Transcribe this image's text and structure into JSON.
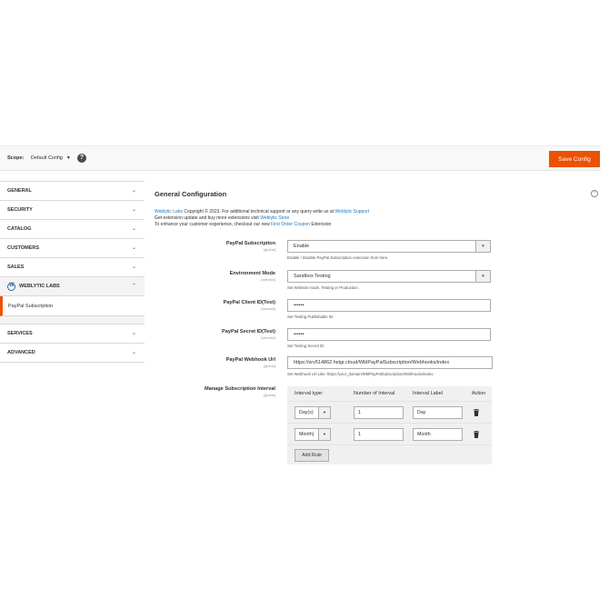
{
  "scope": {
    "label": "Scope:",
    "value": "Default Config",
    "help": "?"
  },
  "save_label": "Save Config",
  "sidebar": {
    "items": [
      {
        "label": "GENERAL"
      },
      {
        "label": "SECURITY"
      },
      {
        "label": "CATALOG"
      },
      {
        "label": "CUSTOMERS"
      },
      {
        "label": "SALES"
      },
      {
        "label": "WEBLYTIC LABS"
      },
      {
        "label": "SERVICES"
      },
      {
        "label": "ADVANCED"
      }
    ],
    "sub_item": "PayPal Subscription"
  },
  "section": {
    "title": "General Configuration",
    "intro": {
      "l1_link": "Weblytic Labs",
      "l1_text": " Copyright © 2023. For additional technical support or any query write us at ",
      "l1_link2": "Weblytic Support",
      "l2_text": "Get extension update and buy more extensions visit ",
      "l2_link": "Weblytic Store",
      "l3_text": "To enhance your customer experience, checkout our new ",
      "l3_link": "First Order Coupon",
      "l3_text2": " Extension"
    }
  },
  "fields": {
    "paypal_subscription": {
      "label": "PayPal Subscription",
      "scope": "[global]",
      "value": "Enable",
      "note": "Enable / Disable PayPal Subscription extension from here."
    },
    "environment_mode": {
      "label": "Environment Mode",
      "scope": "[website]",
      "value": "Sandbox Testing",
      "note": "Set Website mode, Testing or Production."
    },
    "client_id": {
      "label": "PayPal Client ID(Test)",
      "scope": "[website]",
      "value": "••••••",
      "note": "Set Testing Publishable ID."
    },
    "secret_id": {
      "label": "PayPal Secret ID(Test)",
      "scope": "[website]",
      "value": "••••••",
      "note": "Set Testing Secret ID"
    },
    "webhook_url": {
      "label": "PayPal Webhook Url",
      "scope": "[global]",
      "value": "https://srv514862.hstgr.cloud/WblPayPalSubscription/Webhooks/index",
      "note": "Set Webhook Url Like: https://your_domain/WblPayPalSubscription/Webhooks/index."
    },
    "interval": {
      "label": "Manage Subscription Interval",
      "scope": "[global]",
      "headers": {
        "type": "Interval type:",
        "number": "Number of Interval",
        "label": "Interval Label",
        "action": "Action"
      },
      "rows": [
        {
          "type": "Day(s)",
          "number": "1",
          "label": "Day"
        },
        {
          "type": "Month(",
          "number": "1",
          "label": "Month"
        }
      ],
      "add_rule": "Add Rule"
    }
  },
  "icons": {
    "help": "help-icon",
    "chevron": "chevron-down-icon",
    "trash": "trash-icon",
    "logo": "weblytic-logo-icon",
    "collapse": "collapse-icon"
  },
  "colors": {
    "accent": "#eb5202",
    "link": "#1979c3"
  }
}
